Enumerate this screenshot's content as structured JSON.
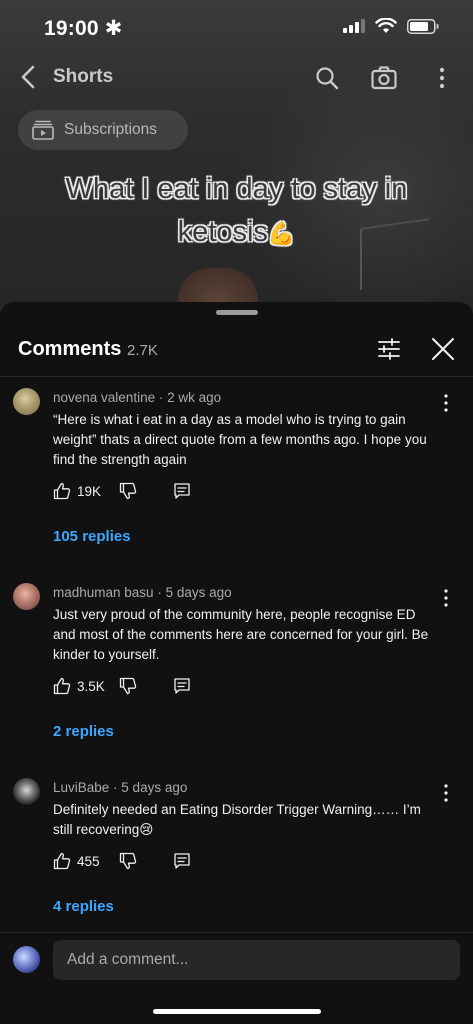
{
  "status_bar": {
    "time": "19:00"
  },
  "nav": {
    "title": "Shorts"
  },
  "chip": {
    "label": "Subscriptions"
  },
  "video": {
    "caption_line1": "What I eat in day to stay in",
    "caption_line2": "ketosis",
    "caption_emoji": "💪"
  },
  "comments_header": {
    "title": "Comments",
    "count": "2.7K"
  },
  "comments": [
    {
      "author": "novena valentine",
      "age": "2 wk ago",
      "text": "“Here is what i eat in a day as a model who is trying to gain weight” thats a direct quote from a few months ago. I hope you find the strength again",
      "likes": "19K",
      "replies": "105 replies"
    },
    {
      "author": "madhuman basu",
      "age": "5 days ago",
      "text": "Just very proud of the community here, people recognise ED and most of the comments here are concerned for your girl. Be kinder to yourself.",
      "likes": "3.5K",
      "replies": "2 replies"
    },
    {
      "author": "LuviBabe",
      "age": "5 days ago",
      "text": "Definitely needed an Eating Disorder Trigger Warning…… I’m still recovering😢",
      "likes": "455",
      "replies": "4 replies"
    }
  ],
  "composer": {
    "placeholder": "Add a comment..."
  },
  "colors": {
    "accent_link": "#3ea6ff",
    "sheet_bg": "#111111",
    "input_bg": "#272727"
  },
  "icons": [
    "back-icon",
    "search-icon",
    "camera-icon",
    "more-vert-icon",
    "subscriptions-icon",
    "filter-icon",
    "close-icon",
    "thumbs-up-icon",
    "thumbs-down-icon",
    "reply-icon"
  ]
}
